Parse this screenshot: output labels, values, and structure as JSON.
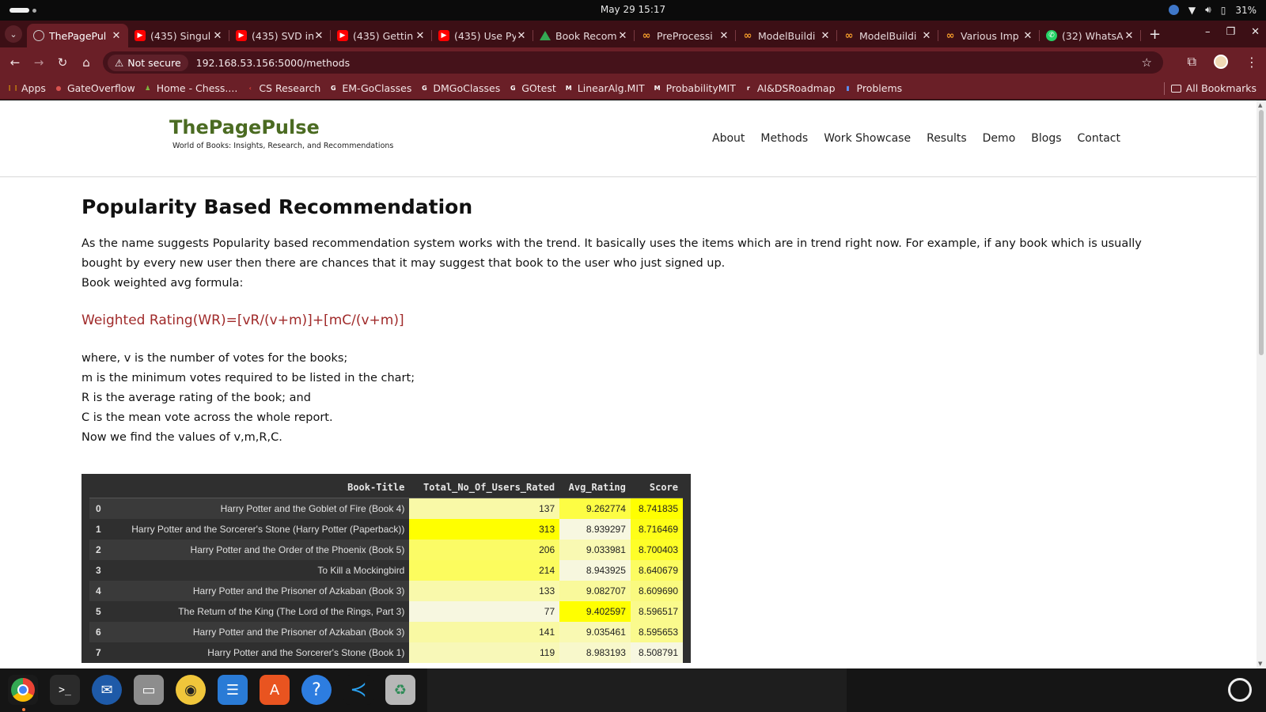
{
  "system": {
    "clock": "May 29  15:17",
    "battery": "31%"
  },
  "tabs": [
    {
      "title": "ThePagePul",
      "icon": "page-icon",
      "active": true
    },
    {
      "title": "(435) Singul",
      "icon": "youtube-icon"
    },
    {
      "title": "(435) SVD in",
      "icon": "youtube-icon"
    },
    {
      "title": "(435) Gettin",
      "icon": "youtube-icon"
    },
    {
      "title": "(435) Use Py",
      "icon": "youtube-icon"
    },
    {
      "title": "Book Recom",
      "icon": "google-drive-icon"
    },
    {
      "title": "PreProcessi",
      "icon": "colab-icon"
    },
    {
      "title": "ModelBuildi",
      "icon": "colab-icon"
    },
    {
      "title": "ModelBuildi",
      "icon": "colab-icon"
    },
    {
      "title": "Various Imp",
      "icon": "colab-icon"
    },
    {
      "title": "(32) WhatsA",
      "icon": "whatsapp-icon"
    }
  ],
  "address": {
    "security": "Not secure",
    "url": "192.168.53.156:5000/methods"
  },
  "bookmarks": [
    {
      "label": "Apps",
      "color": "#f4b400",
      "glyph": "⋮⋮"
    },
    {
      "label": "GateOverflow",
      "color": "#d9534f",
      "glyph": "●"
    },
    {
      "label": "Home - Chess....",
      "color": "#7fb640",
      "glyph": "♟"
    },
    {
      "label": "CS Research",
      "color": "#e8453c",
      "glyph": "‹"
    },
    {
      "label": "EM-GoClasses",
      "color": "#ffffff",
      "glyph": "G"
    },
    {
      "label": "DMGoClasses",
      "color": "#ffffff",
      "glyph": "G"
    },
    {
      "label": "GOtest",
      "color": "#ffffff",
      "glyph": "G"
    },
    {
      "label": "LinearAlg.MIT",
      "color": "#ffffff",
      "glyph": "M"
    },
    {
      "label": "ProbabilityMIT",
      "color": "#ffffff",
      "glyph": "M"
    },
    {
      "label": "AI&DSRoadmap",
      "color": "#ffffff",
      "glyph": "r"
    },
    {
      "label": "Problems",
      "color": "#5b8def",
      "glyph": "▮"
    }
  ],
  "all_bookmarks": "All Bookmarks",
  "site": {
    "brand": "ThePagePulse",
    "tagline": "World of Books: Insights, Research, and Recommendations",
    "nav": [
      "About",
      "Methods",
      "Work Showcase",
      "Results",
      "Demo",
      "Blogs",
      "Contact"
    ]
  },
  "content": {
    "heading": "Popularity Based Recommendation",
    "intro": "As the name suggests Popularity based recommendation system works with the trend. It basically uses the items which are in trend right now. For example, if any book which is usually bought by every new user then there are chances that it may suggest that book to the user who just signed up.",
    "formula_label": "Book weighted avg formula:",
    "formula": "Weighted Rating(WR)=[vR/(v+m)]+[mC/(v+m)]",
    "defs": [
      "where, v is the number of votes for the books;",
      "m is the minimum votes required to be listed in the chart;",
      "R is the average rating of the book; and",
      "C is the mean vote across the whole report.",
      "Now we find the values of v,m,R,C."
    ]
  },
  "table": {
    "columns": [
      "",
      "Book-Title",
      "Total_No_Of_Users_Rated",
      "Avg_Rating",
      "Score"
    ],
    "rows": [
      {
        "idx": "0",
        "title": "Harry Potter and the Goblet of Fire (Book 4)",
        "users": "137",
        "avg": "9.262774",
        "score": "8.741835"
      },
      {
        "idx": "1",
        "title": "Harry Potter and the Sorcerer's Stone (Harry Potter (Paperback))",
        "users": "313",
        "avg": "8.939297",
        "score": "8.716469"
      },
      {
        "idx": "2",
        "title": "Harry Potter and the Order of the Phoenix (Book 5)",
        "users": "206",
        "avg": "9.033981",
        "score": "8.700403"
      },
      {
        "idx": "3",
        "title": "To Kill a Mockingbird",
        "users": "214",
        "avg": "8.943925",
        "score": "8.640679"
      },
      {
        "idx": "4",
        "title": "Harry Potter and the Prisoner of Azkaban (Book 3)",
        "users": "133",
        "avg": "9.082707",
        "score": "8.609690"
      },
      {
        "idx": "5",
        "title": "The Return of the King (The Lord of the Rings, Part 3)",
        "users": "77",
        "avg": "9.402597",
        "score": "8.596517"
      },
      {
        "idx": "6",
        "title": "Harry Potter and the Prisoner of Azkaban (Book 3)",
        "users": "141",
        "avg": "9.035461",
        "score": "8.595653"
      },
      {
        "idx": "7",
        "title": "Harry Potter and the Sorcerer's Stone (Book 1)",
        "users": "119",
        "avg": "8.983193",
        "score": "8.508791"
      }
    ],
    "highlight": {
      "max": "#ffff00",
      "min": "#f7f7e0"
    }
  },
  "dock": [
    "chrome-icon",
    "terminal-icon",
    "thunderbird-icon",
    "files-icon",
    "rhythmbox-icon",
    "writer-icon",
    "app-center-icon",
    "help-icon",
    "vscode-icon",
    "trash-icon"
  ]
}
